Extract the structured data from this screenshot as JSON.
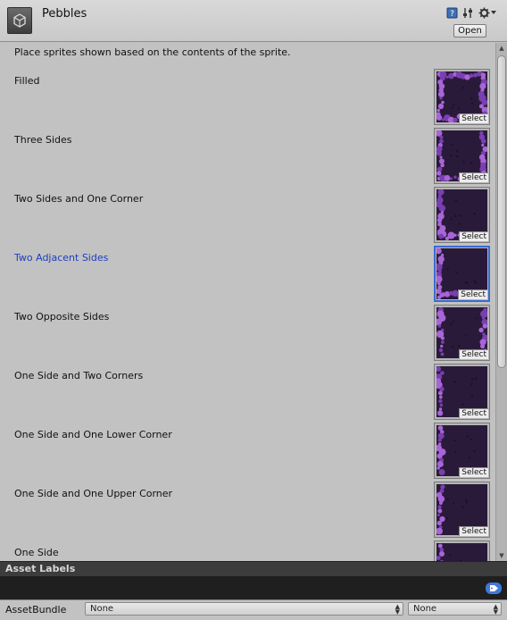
{
  "header": {
    "title": "Pebbles",
    "open_label": "Open",
    "icons": [
      "unity-asset-icon",
      "help-book-icon",
      "preset-sliders-icon",
      "gear-icon"
    ]
  },
  "intro_text": "Place sprites shown based on the contents of the sprite.",
  "select_label": "Select",
  "rules": [
    {
      "label": "Filled",
      "active": false
    },
    {
      "label": "Three Sides",
      "active": false
    },
    {
      "label": "Two Sides and One Corner",
      "active": false
    },
    {
      "label": "Two Adjacent Sides",
      "active": true
    },
    {
      "label": "Two Opposite Sides",
      "active": false
    },
    {
      "label": "One Side and Two Corners",
      "active": false
    },
    {
      "label": "One Side and One Lower Corner",
      "active": false
    },
    {
      "label": "One Side and One Upper Corner",
      "active": false
    },
    {
      "label": "One Side",
      "active": false
    }
  ],
  "asset_labels": {
    "title": "Asset Labels"
  },
  "asset_bundle": {
    "label": "AssetBundle",
    "name_value": "None",
    "variant_value": "None"
  },
  "colors": {
    "sprite_bg": "#2a1a3a",
    "pebble": "#a865d8",
    "active_label": "#1a3fbf",
    "selected_border": "#3a6ad4"
  }
}
